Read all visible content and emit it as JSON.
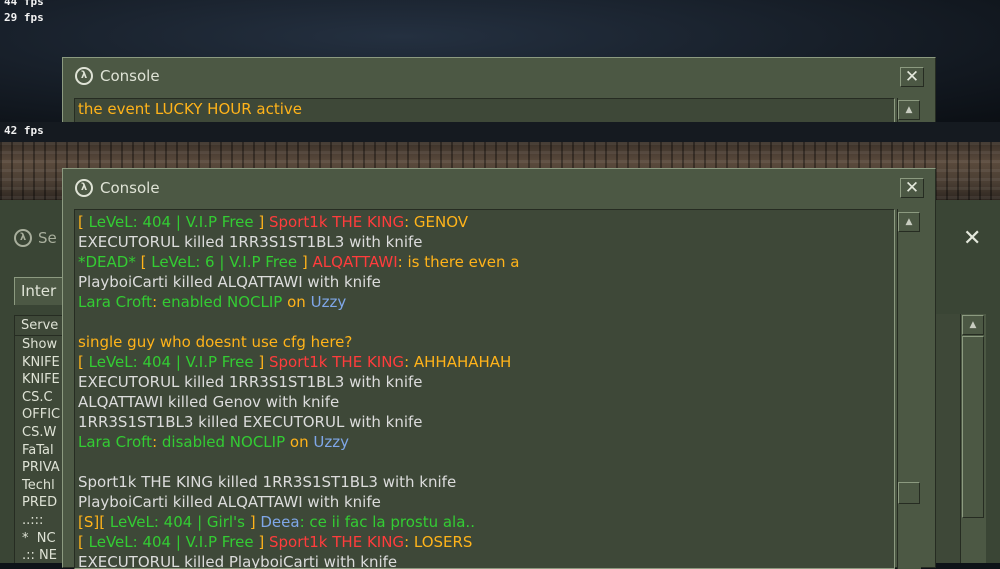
{
  "fps": {
    "top": "29 fps",
    "top_partial": "44 fps",
    "middle": "42 fps"
  },
  "console_top": {
    "title": "Console",
    "close_label": "✕",
    "line": [
      {
        "text": "the event LUCKY HOUR active",
        "color": "y"
      }
    ]
  },
  "server_window": {
    "title_partial": "Se",
    "close_label": "✕",
    "tab_partial": "Inter",
    "column_partial": "Serve",
    "items": [
      "Show",
      "KNIFE",
      "KNIFE",
      "CS.C",
      "OFFIC",
      "CS.W",
      "FaTal",
      "PRIVA",
      "Techl",
      "PRED",
      "..:::",
      "*  NC",
      ".:: NE"
    ]
  },
  "console_main": {
    "title": "Console",
    "close_label": "✕",
    "lines": [
      [
        {
          "t": "[ ",
          "c": "y"
        },
        {
          "t": "LeVeL",
          "c": "g"
        },
        {
          "t": ": 404 | ",
          "c": "g"
        },
        {
          "t": "V.I.P Free",
          "c": "g"
        },
        {
          "t": " ] ",
          "c": "y"
        },
        {
          "t": "Sport1k THE KING",
          "c": "r"
        },
        {
          "t": ": GENOV",
          "c": "y"
        }
      ],
      [
        {
          "t": "EXECUTORUL killed 1RR3S1ST1BL3 with knife",
          "c": "w"
        }
      ],
      [
        {
          "t": "*DEAD* ",
          "c": "g"
        },
        {
          "t": "[ ",
          "c": "y"
        },
        {
          "t": "LeVeL: 6 | V.I.P Free",
          "c": "g"
        },
        {
          "t": " ] ",
          "c": "y"
        },
        {
          "t": "ALQATTAWI",
          "c": "r"
        },
        {
          "t": ": is there even a",
          "c": "y"
        }
      ],
      [
        {
          "t": "PlayboiCarti killed ALQATTAWI with knife",
          "c": "w"
        }
      ],
      [
        {
          "t": "Lara Croft",
          "c": "g"
        },
        {
          "t": ": ",
          "c": "y"
        },
        {
          "t": "enabled NOCLIP",
          "c": "g"
        },
        {
          "t": " on ",
          "c": "y"
        },
        {
          "t": "Uzzy",
          "c": "b"
        }
      ],
      [
        {
          "t": " ",
          "c": "w"
        }
      ],
      [
        {
          "t": "single guy who doesnt use cfg here?",
          "c": "y"
        }
      ],
      [
        {
          "t": "[ ",
          "c": "y"
        },
        {
          "t": "LeVeL: 404 | V.I.P Free",
          "c": "g"
        },
        {
          "t": " ] ",
          "c": "y"
        },
        {
          "t": "Sport1k THE KING",
          "c": "r"
        },
        {
          "t": ": AHHAHAHAH",
          "c": "y"
        }
      ],
      [
        {
          "t": "EXECUTORUL killed 1RR3S1ST1BL3 with knife",
          "c": "w"
        }
      ],
      [
        {
          "t": "ALQATTAWI killed Genov with knife",
          "c": "w"
        }
      ],
      [
        {
          "t": "1RR3S1ST1BL3 killed EXECUTORUL with knife",
          "c": "w"
        }
      ],
      [
        {
          "t": "Lara Croft",
          "c": "g"
        },
        {
          "t": ": ",
          "c": "y"
        },
        {
          "t": "disabled NOCLIP",
          "c": "g"
        },
        {
          "t": " on ",
          "c": "y"
        },
        {
          "t": "Uzzy",
          "c": "b"
        }
      ],
      [
        {
          "t": " ",
          "c": "w"
        }
      ],
      [
        {
          "t": "Sport1k THE KING killed 1RR3S1ST1BL3 with knife",
          "c": "w"
        }
      ],
      [
        {
          "t": "PlayboiCarti killed ALQATTAWI with knife",
          "c": "w"
        }
      ],
      [
        {
          "t": "[S]",
          "c": "y"
        },
        {
          "t": "[ ",
          "c": "y"
        },
        {
          "t": "LeVeL: 404 | Girl's",
          "c": "g"
        },
        {
          "t": " ] ",
          "c": "y"
        },
        {
          "t": "Deea",
          "c": "b"
        },
        {
          "t": ": ce ii fac la prostu ala..",
          "c": "g"
        }
      ],
      [
        {
          "t": "[ ",
          "c": "y"
        },
        {
          "t": "LeVeL: 404 | V.I.P Free",
          "c": "g"
        },
        {
          "t": " ] ",
          "c": "y"
        },
        {
          "t": "Sport1k THE KING",
          "c": "r"
        },
        {
          "t": ": LOSERS",
          "c": "y"
        }
      ],
      [
        {
          "t": "EXECUTORUL killed PlayboiCarti with knife",
          "c": "w"
        }
      ]
    ]
  },
  "colors": {
    "w": "#dcdcdc",
    "y": "#ffb31a",
    "g": "#33cc33",
    "r": "#ff3c3c",
    "b": "#7fa7e8",
    "window_bg": "#4c5844",
    "log_bg": "#3e4838"
  },
  "icons": {
    "console_logo": "halflife-logo-icon",
    "close": "close-icon",
    "scroll_up": "arrow-up-icon"
  }
}
